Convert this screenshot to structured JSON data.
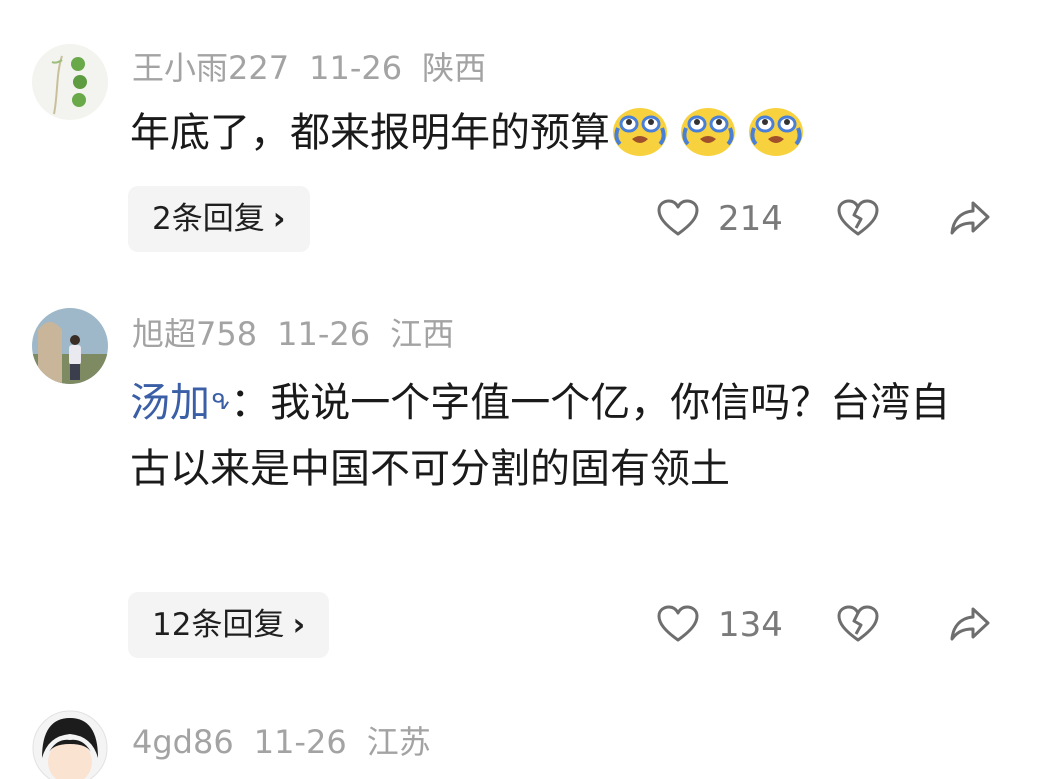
{
  "comments": [
    {
      "username": "王小雨227",
      "date": "11-26",
      "location": "陕西",
      "text": "年底了，都来报明年的预算",
      "emoji_icon": "crying-laughing-emoji",
      "replies_label": "2条回复",
      "likes": "214"
    },
    {
      "username": "旭超758",
      "date": "11-26",
      "location": "江西",
      "mention": "汤加",
      "mention_mark": "ᕴ",
      "text": "：我说一个字值一个亿，你信吗？台湾自古以来是中国不可分割的固有领土",
      "replies_label": "12条回复",
      "likes": "134"
    },
    {
      "username": "4gd86",
      "date": "11-26",
      "location": "江苏"
    }
  ],
  "icons": {
    "like": "heart-outline-icon",
    "dislike": "broken-heart-icon",
    "share": "share-arrow-icon",
    "chevron": "chevron-right-icon"
  },
  "colors": {
    "meta_gray": "#a3a3a3",
    "text": "#1a1a1a",
    "mention_blue": "#3a5fa6",
    "reply_bg": "#f4f4f4",
    "icon_gray": "#6e6e6e"
  }
}
